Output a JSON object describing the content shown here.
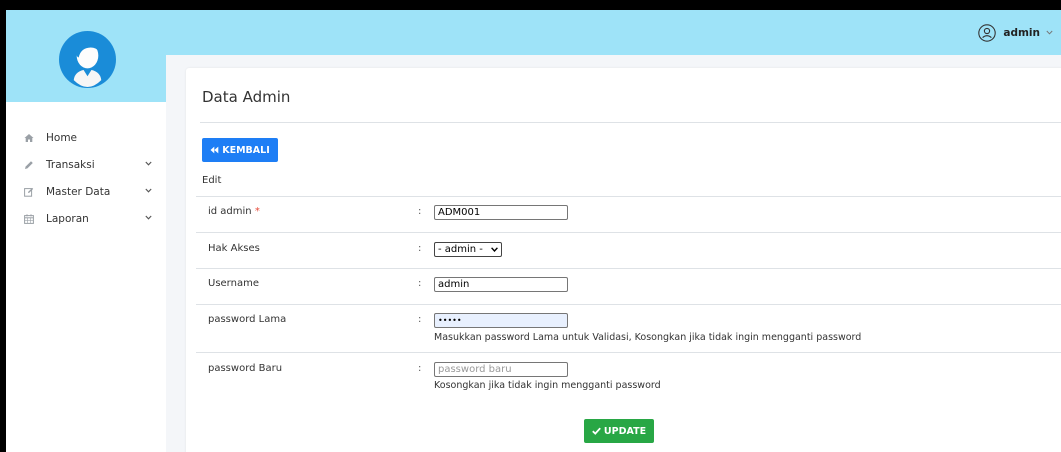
{
  "sidebar": {
    "items": [
      {
        "label": "Home",
        "icon": "home-icon",
        "has_chevron": false
      },
      {
        "label": "Transaksi",
        "icon": "pencil-icon",
        "has_chevron": true
      },
      {
        "label": "Master Data",
        "icon": "edit-icon",
        "has_chevron": true
      },
      {
        "label": "Laporan",
        "icon": "calendar-icon",
        "has_chevron": true
      }
    ]
  },
  "topbar": {
    "user": "admin"
  },
  "page": {
    "title": "Data Admin",
    "back_label": "KEMBALI",
    "edit_label": "Edit",
    "update_label": "UPDATE"
  },
  "form": {
    "id_admin": {
      "label": "id admin",
      "required_mark": "*",
      "value": "ADM001"
    },
    "hak_akses": {
      "label": "Hak Akses",
      "selected": "- admin -"
    },
    "username": {
      "label": "Username",
      "value": "admin"
    },
    "password_lama": {
      "label": "password Lama",
      "value": "•••••",
      "help": "Masukkan password Lama untuk Validasi, Kosongkan jika tidak ingin mengganti password"
    },
    "password_baru": {
      "label": "password Baru",
      "placeholder": "password baru",
      "help": "Kosongkan jika tidak ingin mengganti password"
    },
    "colon": ":"
  },
  "colors": {
    "header_bg": "#9ee3f8",
    "primary": "#1e7ef5",
    "success": "#28a745",
    "avatar": "#1a8cd8"
  }
}
